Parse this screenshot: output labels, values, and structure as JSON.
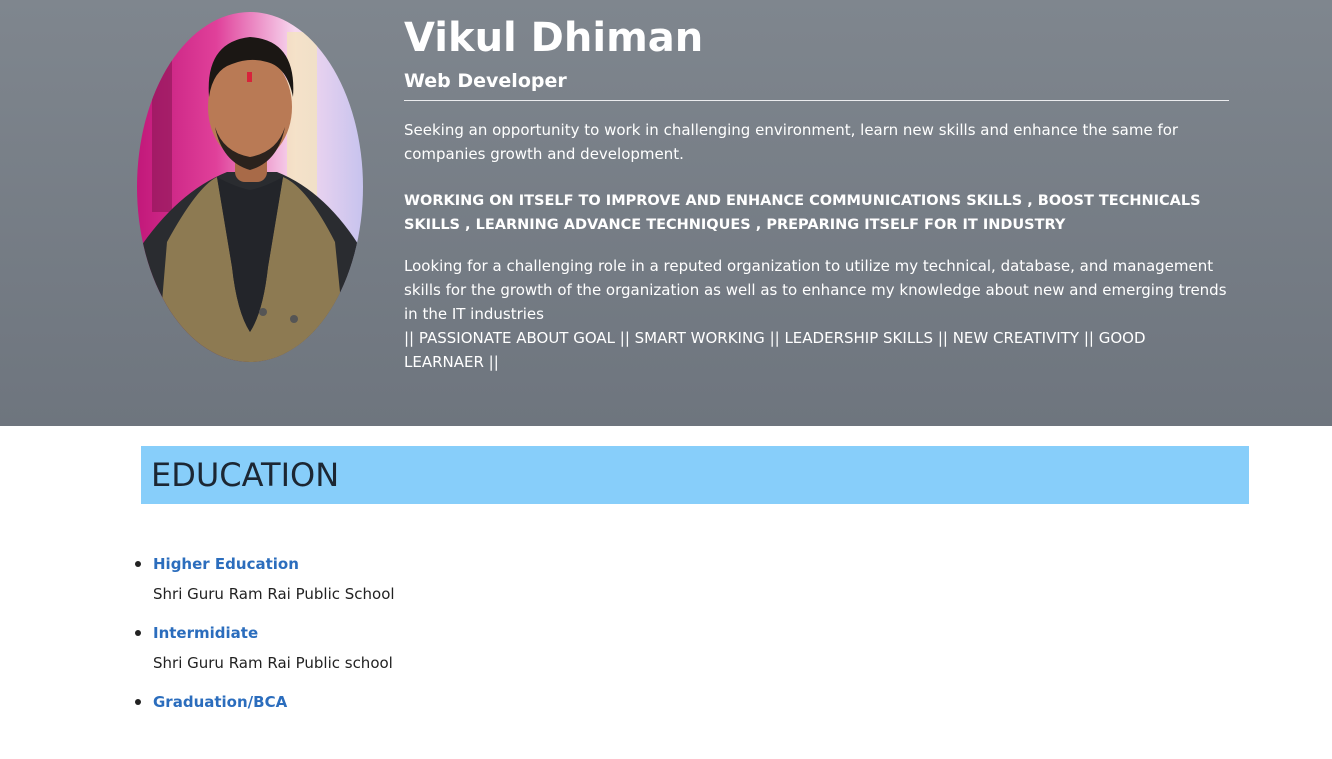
{
  "profile": {
    "name": "Vikul Dhiman",
    "title": "Web Developer",
    "photo_icon": "profile-photo",
    "objective": "Seeking an opportunity to work in challenging environment, learn new skills and enhance the same for companies growth and development.",
    "focus": "WORKING ON ITSELF TO IMPROVE AND ENHANCE COMMUNICATIONS SKILLS , BOOST TECHNICALS SKILLS , LEARNING ADVANCE TECHNIQUES , PREPARING ITSELF FOR IT INDUSTRY",
    "goal": "Looking for a challenging role in a reputed organization to utilize my technical, database, and management skills for the growth of the organization as well as to enhance my knowledge about new and emerging trends in the IT industries",
    "traits": "|| PASSIONATE ABOUT GOAL || SMART WORKING || LEADERSHIP SKILLS || NEW CREATIVITY || GOOD LEARNAER ||"
  },
  "education": {
    "heading": "EDUCATION",
    "items": [
      {
        "level": "Higher Education",
        "school": "Shri Guru Ram Rai Public School"
      },
      {
        "level": "Intermidiate",
        "school": "Shri Guru Ram Rai Public school"
      },
      {
        "level": "Graduation/BCA",
        "school": ""
      }
    ]
  },
  "colors": {
    "hero_bg": "#7b828a",
    "section_header_bg": "#87cefa",
    "link": "#2b6dbd"
  }
}
